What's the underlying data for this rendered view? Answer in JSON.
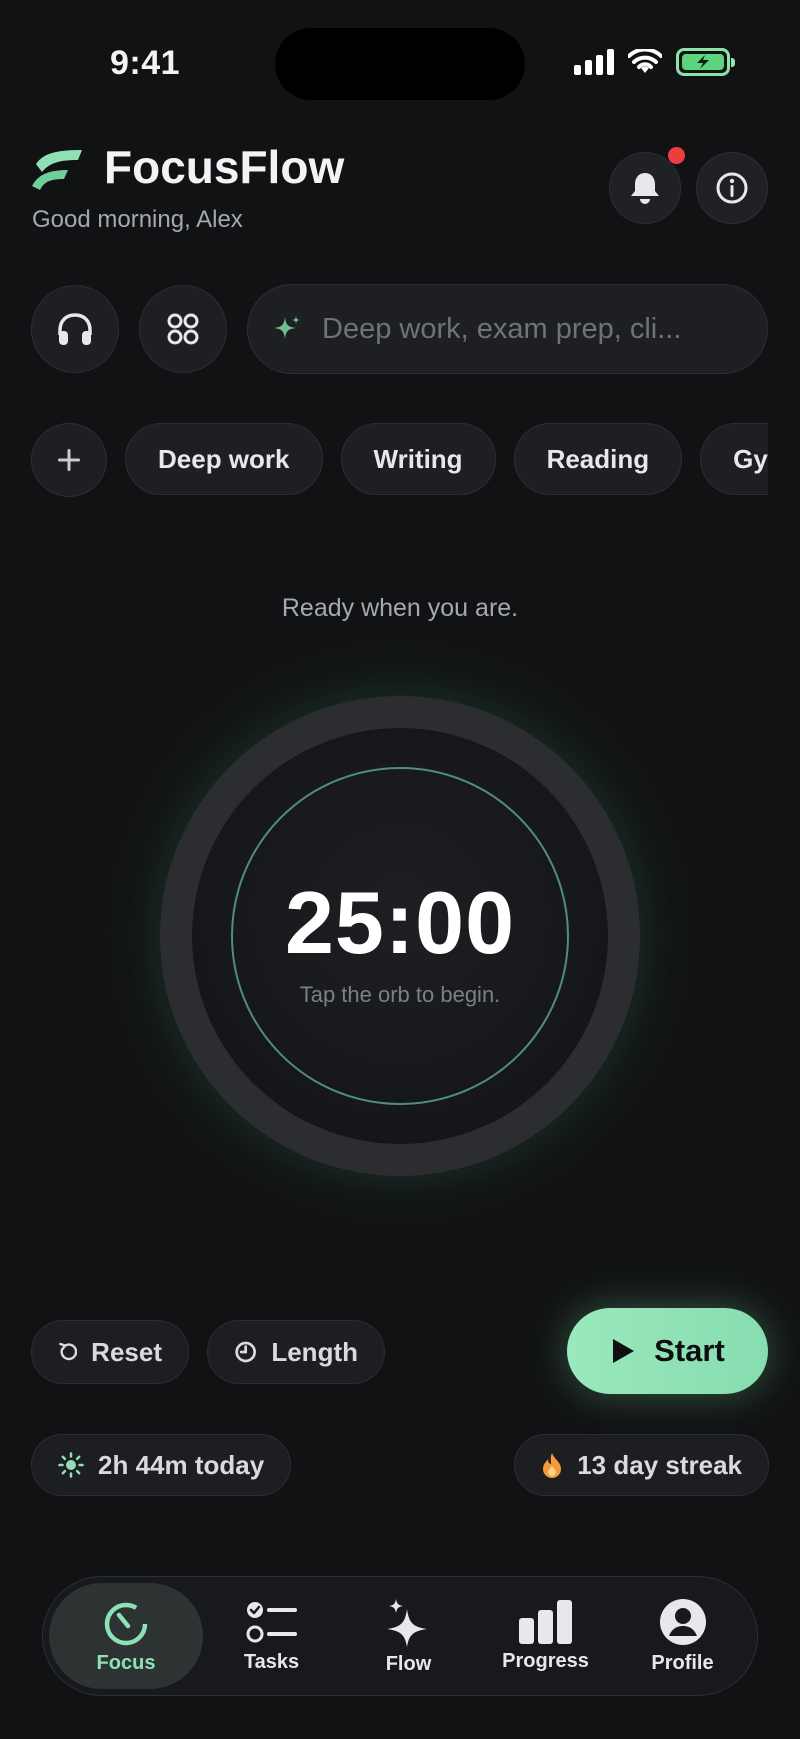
{
  "status": {
    "time": "9:41"
  },
  "header": {
    "title": "FocusFlow",
    "greeting": "Good morning, Alex"
  },
  "search": {
    "placeholder": "Deep work, exam prep, cli..."
  },
  "chips": [
    "Deep work",
    "Writing",
    "Reading",
    "Gym"
  ],
  "timer": {
    "prompt": "Ready when you are.",
    "time": "25:00",
    "hint": "Tap the orb to begin."
  },
  "controls": {
    "reset_label": "Reset",
    "length_label": "Length",
    "start_label": "Start"
  },
  "stats": {
    "today": "2h 44m today",
    "streak": "13 day streak"
  },
  "nav": {
    "items": [
      {
        "label": "Focus",
        "icon": "timer-icon"
      },
      {
        "label": "Tasks",
        "icon": "checklist-icon"
      },
      {
        "label": "Flow",
        "icon": "sparkles-icon"
      },
      {
        "label": "Progress",
        "icon": "bar-chart-icon"
      },
      {
        "label": "Profile",
        "icon": "profile-icon"
      }
    ]
  },
  "colors": {
    "accent": "#8fe0b5",
    "background": "#111214",
    "notification": "#ef3d3d",
    "streak": "#f39a3b"
  }
}
